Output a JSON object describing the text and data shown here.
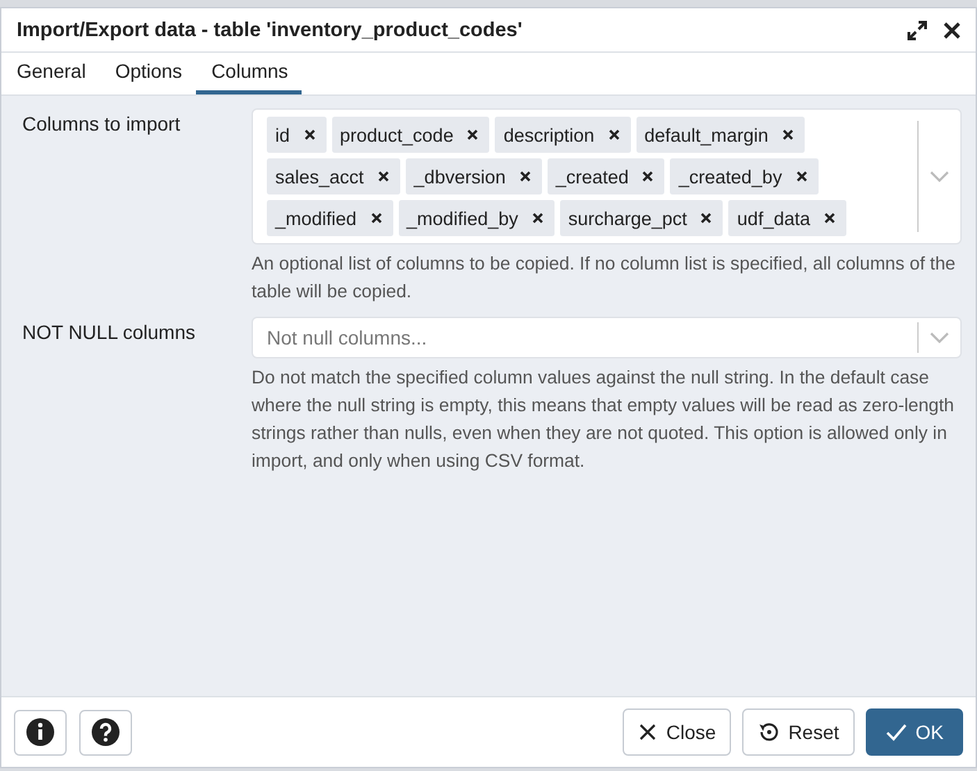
{
  "dialog": {
    "title": "Import/Export data - table 'inventory_product_codes'"
  },
  "tabs": [
    {
      "label": "General",
      "selected": false
    },
    {
      "label": "Options",
      "selected": false
    },
    {
      "label": "Columns",
      "selected": true
    }
  ],
  "fields": [
    {
      "kind": "tags",
      "label": "Columns to import",
      "tags": [
        "id",
        "product_code",
        "description",
        "default_margin",
        "sales_acct",
        "_dbversion",
        "_created",
        "_created_by",
        "_modified",
        "_modified_by",
        "surcharge_pct",
        "udf_data"
      ],
      "help": "An optional list of columns to be copied. If no column list is specified, all columns of the table will be copied."
    },
    {
      "kind": "select",
      "label": "NOT NULL columns",
      "placeholder": "Not null columns...",
      "help": "Do not match the specified column values against the null string. In the default case where the null string is empty, this means that empty values will be read as zero-length strings rather than nulls, even when they are not quoted. This option is allowed only in import, and only when using CSV format."
    }
  ],
  "buttons": [
    {
      "kind": "close",
      "label": "Close"
    },
    {
      "kind": "reset",
      "label": "Reset"
    },
    {
      "kind": "ok",
      "label": "OK"
    }
  ]
}
